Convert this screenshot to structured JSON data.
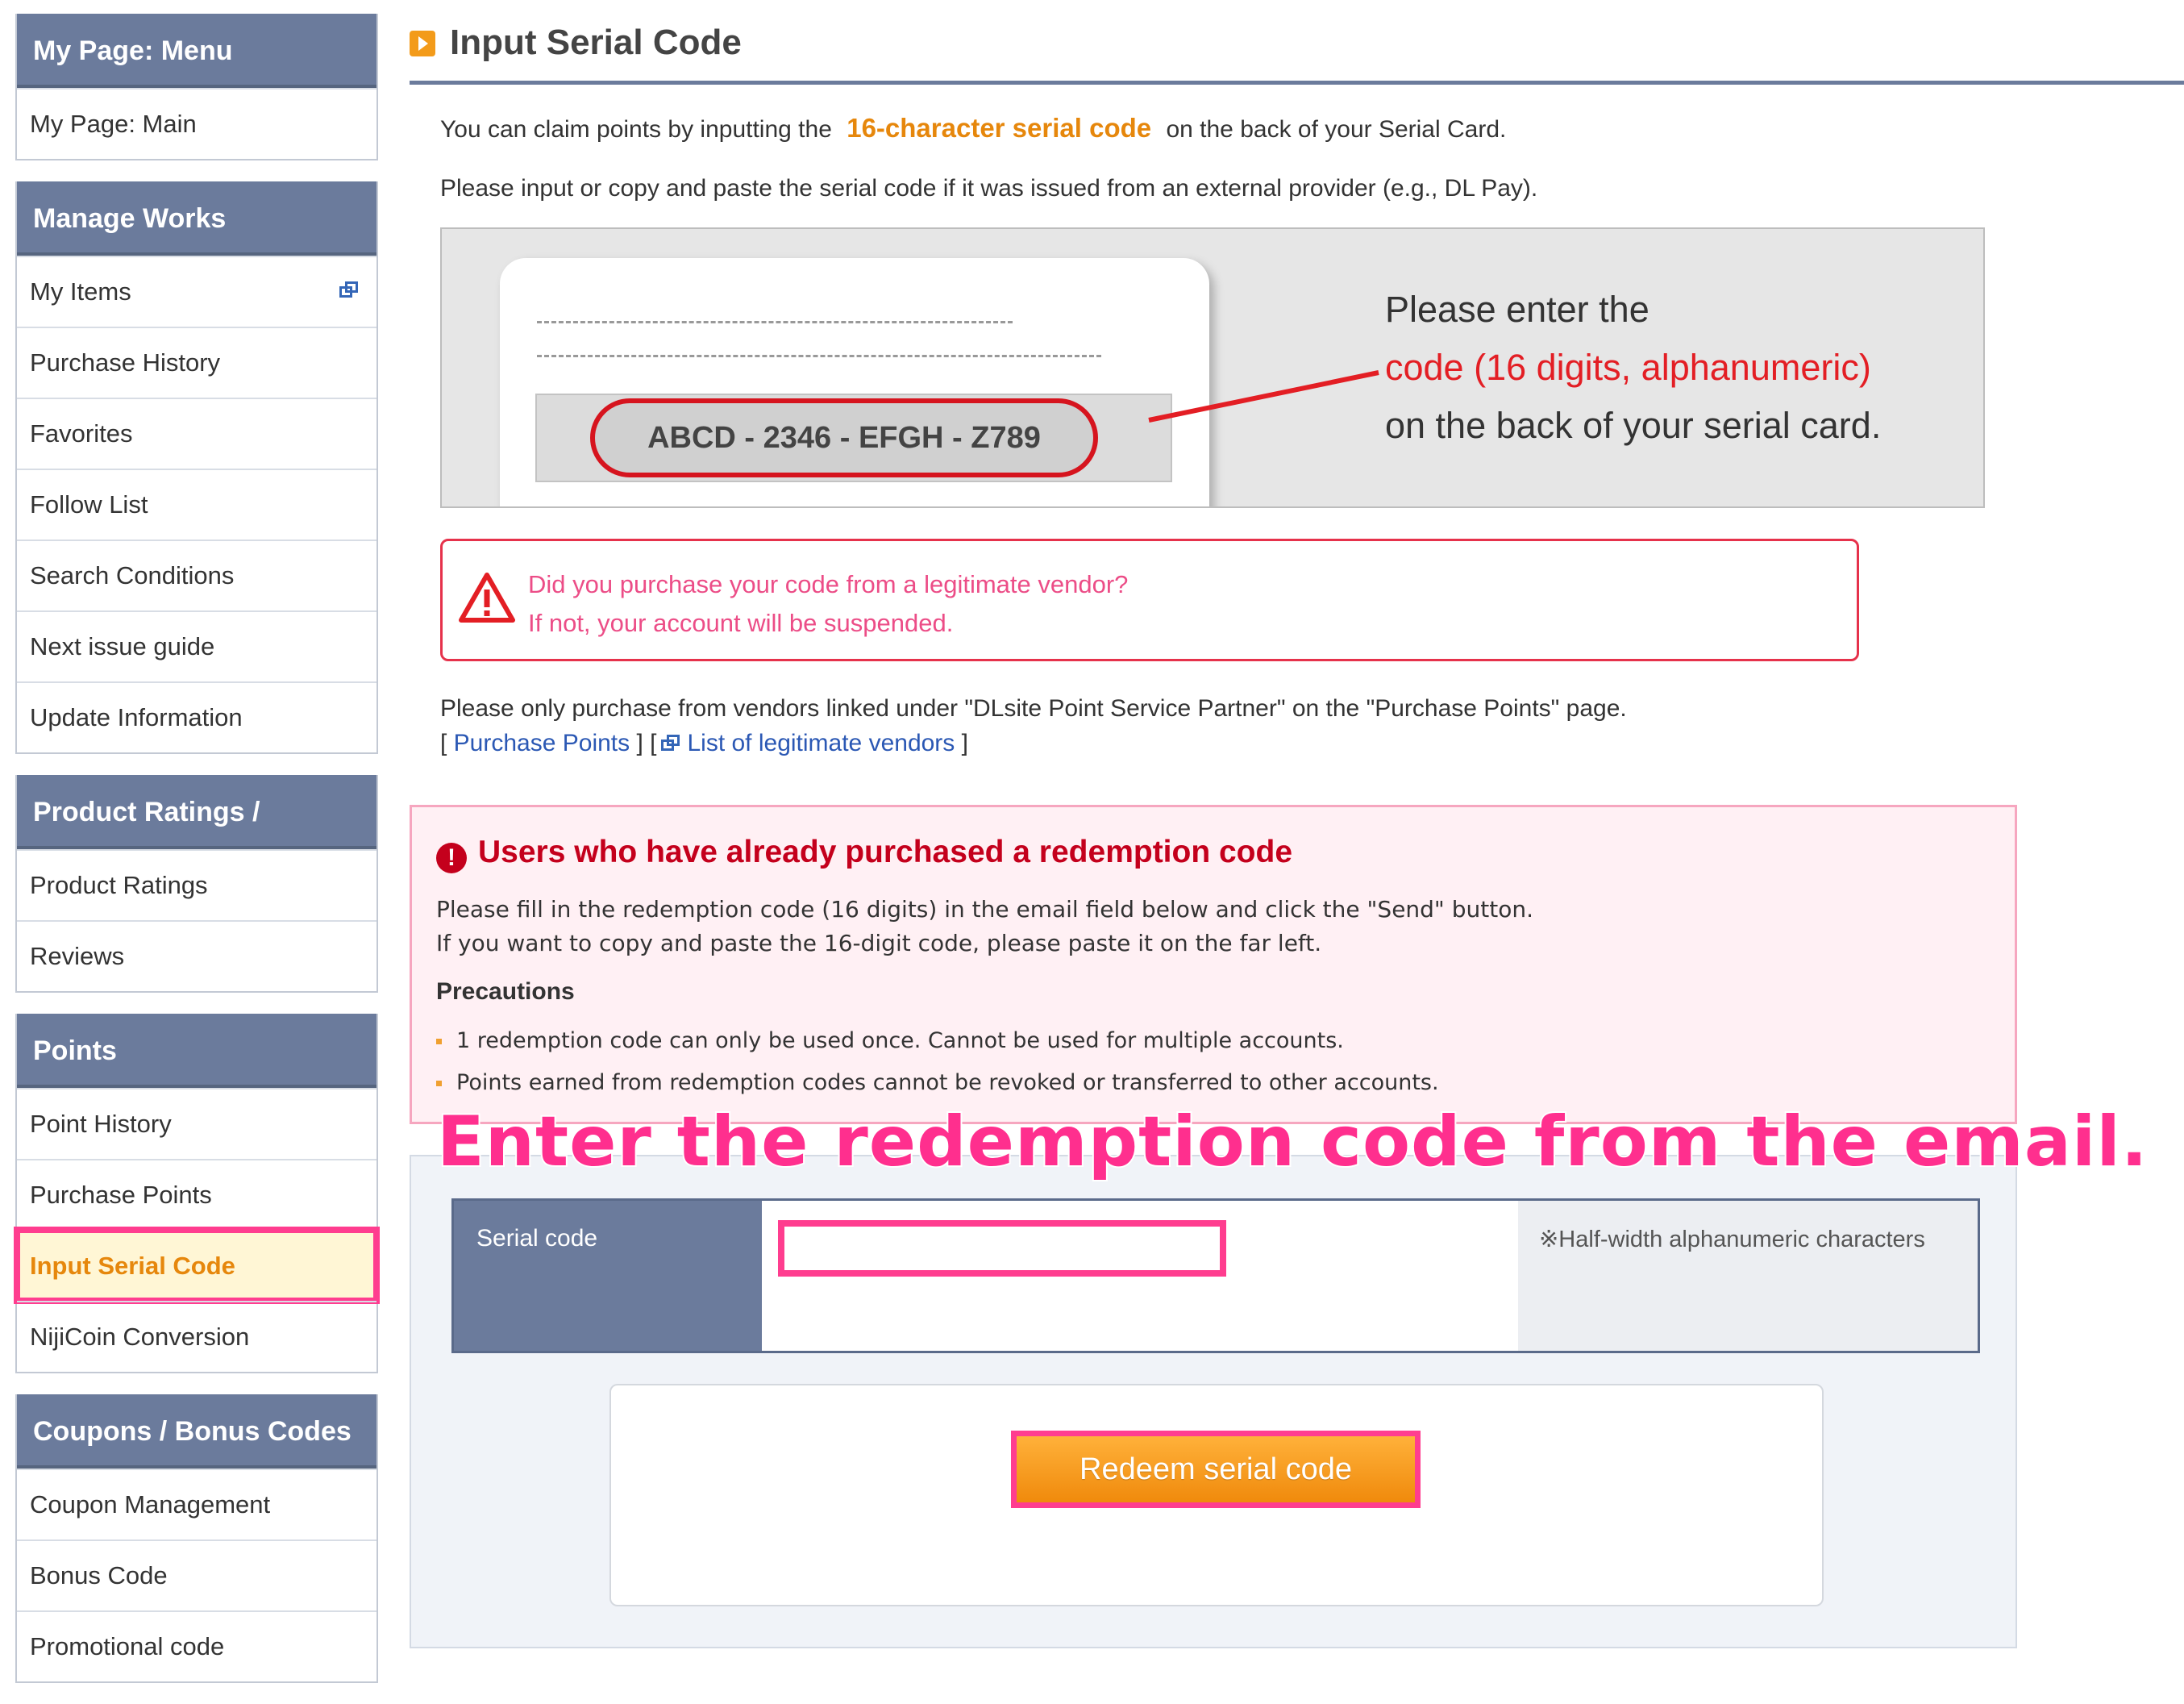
{
  "sidebar": {
    "groups": [
      {
        "title": "My Page: Menu",
        "items": [
          {
            "label": "My Page: Main"
          }
        ]
      },
      {
        "title": "Manage Works",
        "items": [
          {
            "label": "My Items",
            "icon": "external-window-icon"
          },
          {
            "label": "Purchase History"
          },
          {
            "label": "Favorites"
          },
          {
            "label": "Follow List"
          },
          {
            "label": "Search Conditions"
          },
          {
            "label": "Next issue guide"
          },
          {
            "label": "Update Information"
          }
        ]
      },
      {
        "title": "Product Ratings / Reviews",
        "items": [
          {
            "label": "Product Ratings"
          },
          {
            "label": "Reviews"
          }
        ]
      },
      {
        "title": "Points",
        "items": [
          {
            "label": "Point History"
          },
          {
            "label": "Purchase Points"
          },
          {
            "label": "Input Serial Code",
            "active": true
          },
          {
            "label": "NijiCoin Conversion"
          }
        ]
      },
      {
        "title": "Coupons / Bonus Codes",
        "items": [
          {
            "label": "Coupon Management"
          },
          {
            "label": "Bonus Code"
          },
          {
            "label": "Promotional code"
          }
        ]
      }
    ]
  },
  "main": {
    "title": "Input Serial Code",
    "intro": {
      "before": "You can claim points by inputting the",
      "highlight": "16-character serial code",
      "after": "on the back of your Serial Card.",
      "line2": "Please input or copy and paste the serial code if it was issued from an external provider (e.g., DL Pay)."
    },
    "card": {
      "sample_code": "ABCD - 2346 - EFGH - Z789",
      "line1": "Please enter the",
      "line2_red": "code (16 digits, alphanumeric)",
      "line3": "on the back of your serial card."
    },
    "warning": {
      "line1": "Did you purchase your code from a legitimate vendor?",
      "line2": "If not, your account will be suspended."
    },
    "vendors": {
      "text": "Please only purchase from vendors linked under \"DLsite Point Service Partner\" on the \"Purchase Points\" page.",
      "link1": "Purchase Points",
      "link2": "List of legitimate vendors"
    },
    "notice": {
      "heading": "Users who have already purchased a redemption code",
      "p1": "Please fill in the redemption code (16 digits) in the email field below and click the \"Send\" button.",
      "p2": "If you want to copy and paste the 16-digit code, please paste it on the far left.",
      "precautions_title": "Precautions",
      "precautions": [
        "1 redemption code can only be used once. Cannot be used for multiple accounts.",
        "Points earned from redemption codes cannot be revoked or transferred to other accounts."
      ]
    },
    "caption": "Enter the redemption code from the email.",
    "form": {
      "label": "Serial code",
      "value": "",
      "note": "※Half-width alphanumeric characters",
      "button": "Redeem serial code"
    }
  },
  "colors": {
    "sidebar_header": "#6b7b9c",
    "accent_orange": "#e6870c",
    "highlight_pink": "#ff3d8f",
    "warning_red": "#e6324b",
    "notice_red": "#c4001c",
    "link_blue": "#2b58b4"
  }
}
